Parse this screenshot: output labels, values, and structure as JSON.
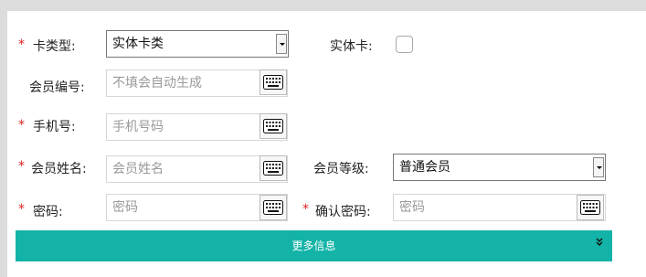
{
  "form": {
    "card_type": {
      "required": "*",
      "label": "卡类型:",
      "value": "实体卡类"
    },
    "physical_card": {
      "label": "实体卡:"
    },
    "member_no": {
      "label": "会员编号:",
      "placeholder": "不填会自动生成"
    },
    "phone": {
      "required": "*",
      "label": "手机号:",
      "placeholder": "手机号码"
    },
    "member_name": {
      "required": "*",
      "label": "会员姓名:",
      "placeholder": "会员姓名"
    },
    "member_level": {
      "label": "会员等级:",
      "value": "普通会员"
    },
    "password": {
      "required": "*",
      "label": "密码:",
      "placeholder": "密码"
    },
    "confirm_password": {
      "required": "*",
      "label": "确认密码:",
      "placeholder": "密码"
    }
  },
  "more": {
    "label": "更多信息",
    "icon": "double-chevron-down-icon"
  }
}
